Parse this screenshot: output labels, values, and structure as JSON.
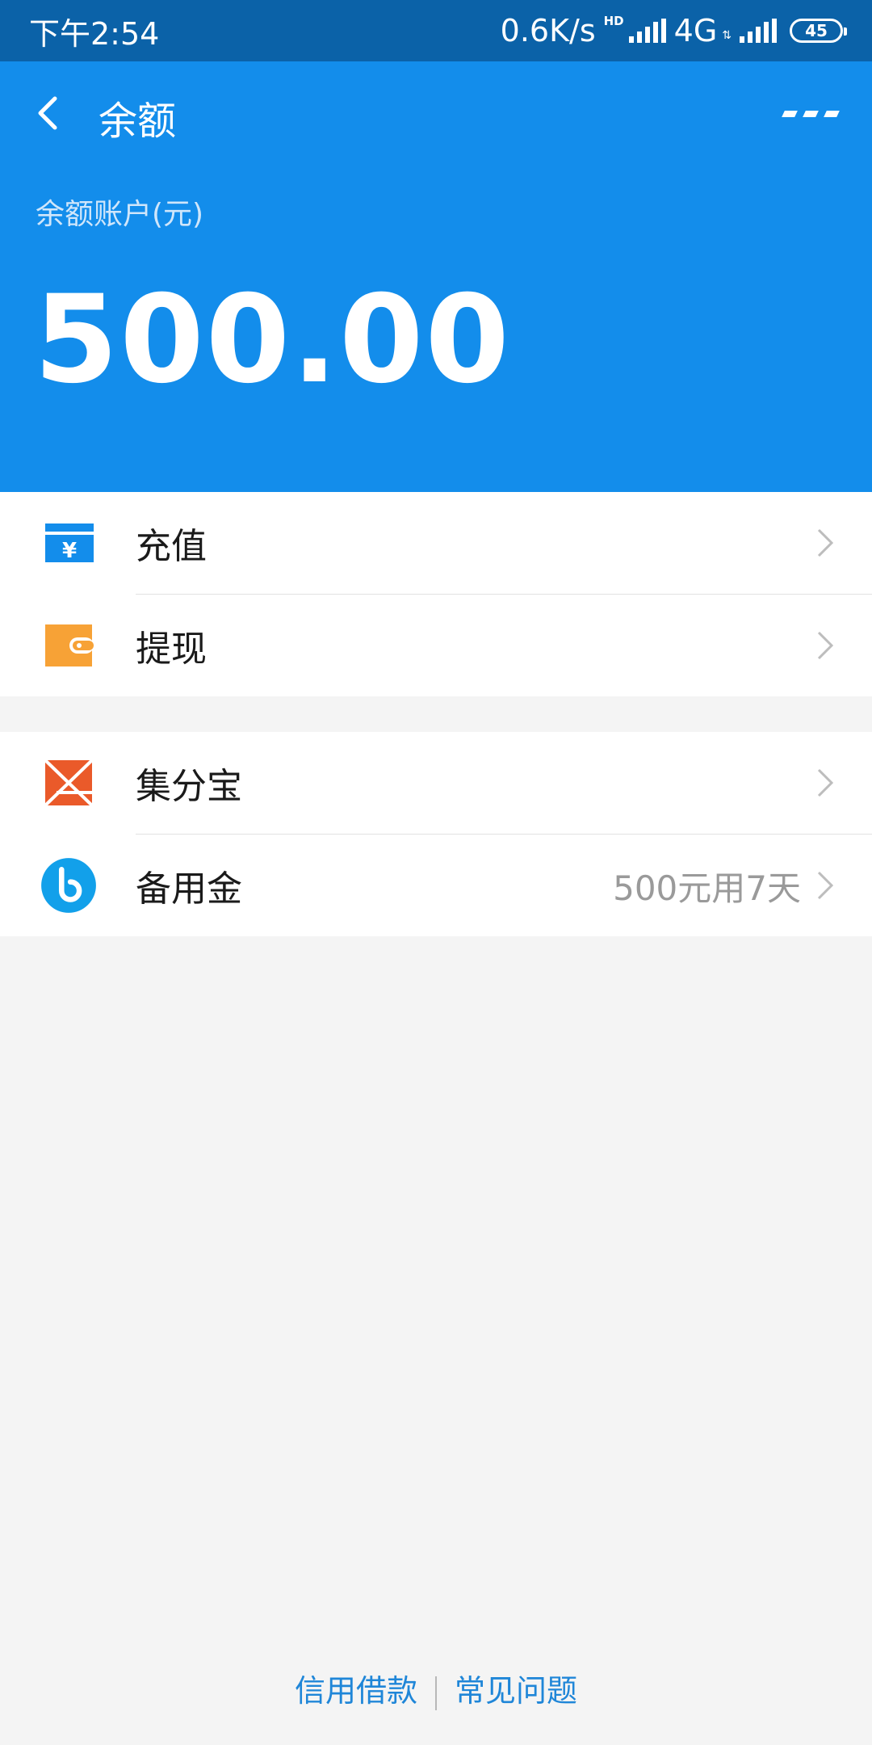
{
  "status_bar": {
    "time": "下午2:54",
    "speed": "0.6K/s",
    "network_type": "4G",
    "hd_label": "HD",
    "battery": "45"
  },
  "header": {
    "title": "余额",
    "balance_label": "余额账户(元)",
    "balance_value": "500.00"
  },
  "list_group_1": [
    {
      "label": "充值",
      "icon": "recharge-icon"
    },
    {
      "label": "提现",
      "icon": "wallet-icon"
    }
  ],
  "list_group_2": [
    {
      "label": "集分宝",
      "icon": "jifenbao-icon"
    },
    {
      "label": "备用金",
      "icon": "beiyongjin-icon",
      "value": "500元用7天"
    }
  ],
  "footer": {
    "link_1": "信用借款",
    "link_2": "常见问题"
  },
  "colors": {
    "primary_blue": "#138deb",
    "status_bar": "#0b62a8",
    "wallet_orange": "#f7a236",
    "jifenbao_red": "#ea5a2a"
  }
}
